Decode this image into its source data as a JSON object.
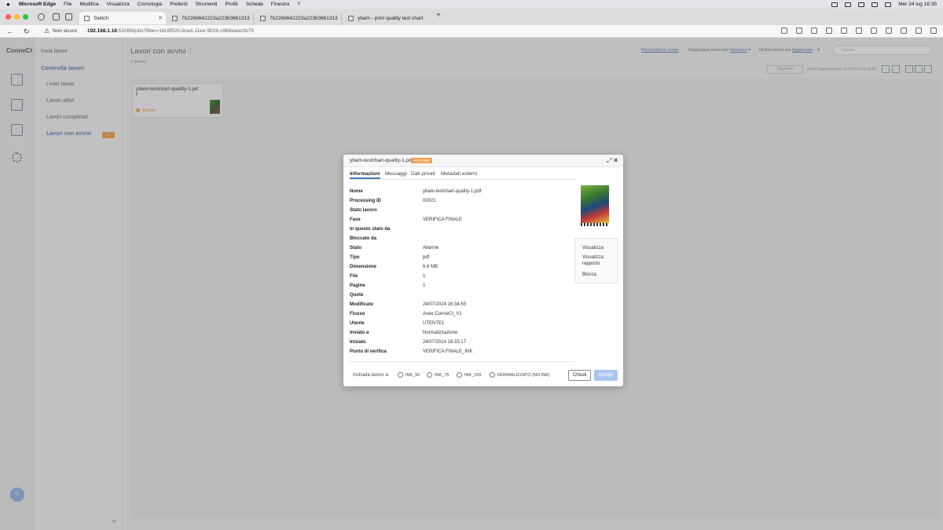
{
  "menubar": {
    "app": "Microsoft Edge",
    "items": [
      "File",
      "Modifica",
      "Visualizza",
      "Cronologia",
      "Preferiti",
      "Strumenti",
      "Profili",
      "Scheda",
      "Finestra",
      "?"
    ],
    "datetime": "Mer 24 lug  16:35"
  },
  "tabs": [
    {
      "label": "Switch"
    },
    {
      "label": "7b2269642223a22363661313"
    },
    {
      "label": "7b2269642223a22363661313"
    },
    {
      "label": "ybam - print quality test chart"
    }
  ],
  "address": {
    "security": "Non sicuro",
    "host": "192.168.1.16",
    "rest": ":51089/jobs?filter=18c9f520-dca4-11ee-9028-c986eaec0b79"
  },
  "rail": {
    "logo": "ConneCt",
    "avatar": "U"
  },
  "sidebar": {
    "send": "Invia lavori",
    "control": "Controlla lavori",
    "items": [
      "I miei lavori",
      "Lavori attivi",
      "Lavori completati",
      "Lavori con avvisi"
    ],
    "badge": "1"
  },
  "main": {
    "title": "Lavori con avvisi",
    "count": "1 lavoro",
    "customize": "Personalizza campi",
    "group_label": "Raggruppa lavori per",
    "group_value": "Nessuno",
    "sort_label": "Ordina lavori per",
    "sort_value": "Aggiornato",
    "search_placeholder": "Cerca",
    "refresh": "Aggiorna",
    "last_update": "Ultimo aggiornamento: 24/07/2024 16:35:28"
  },
  "job_card": {
    "name": "ybam-testchart-quality-1.pd f",
    "status": "Allarme"
  },
  "modal": {
    "title": "ybam-testchart-quality-1.pdf",
    "badge": "ALLARME",
    "tabs": [
      "Informazioni",
      "Messaggi",
      "Dati privati",
      "Metadati esterni"
    ],
    "fields": [
      {
        "k": "Nome",
        "v": "ybam-testchart-quality-1.pdf"
      },
      {
        "k": "Processing ID",
        "v": "00021"
      },
      {
        "k": "Stato lavoro",
        "v": ""
      },
      {
        "k": "Fase",
        "v": "VERIFICA FINALE"
      },
      {
        "k": "In questo stato da",
        "v": ""
      },
      {
        "k": "Bloccato da",
        "v": ""
      },
      {
        "k": "Stato",
        "v": "Allarme"
      },
      {
        "k": "Tipo",
        "v": "pdf"
      },
      {
        "k": "Dimensione",
        "v": "6.6 MB"
      },
      {
        "k": "File",
        "v": "1"
      },
      {
        "k": "Pagine",
        "v": "1"
      },
      {
        "k": "Quote",
        "v": ""
      },
      {
        "k": "Modificato",
        "v": "24/07/2024 16:34:55"
      },
      {
        "k": "Flusso",
        "v": "Axee ConneCt_V1"
      },
      {
        "k": "Utente",
        "v": "UTENTE1"
      },
      {
        "k": "Inviato a",
        "v": "Normalizzazione"
      },
      {
        "k": "Iniziato",
        "v": "24/07/2024 16:33:17"
      },
      {
        "k": "Punto di verifica",
        "v": "VERIFICA FINALE_INK"
      }
    ],
    "actions": [
      "Visualizza",
      "Visualizza rapporto",
      "Blocca"
    ],
    "route_label": "Instrada lavoro a:",
    "route_options": [
      "INK_50",
      "INK_75",
      "INK_100",
      "NORMALIZZATO (NO INK)"
    ],
    "close": "Chiudi",
    "push": "Spinge"
  },
  "colors": {
    "accent": "#5a7fb8",
    "alarm": "#f0a050",
    "primary_button": "#a9c6ee"
  }
}
